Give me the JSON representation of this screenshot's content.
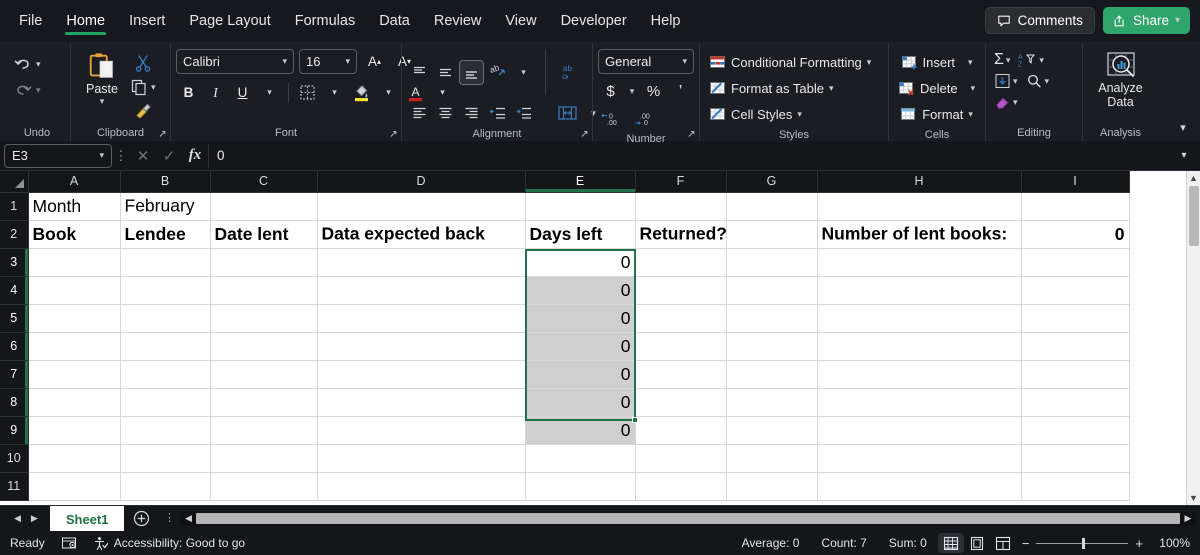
{
  "window": {
    "tabs": [
      "File",
      "Home",
      "Insert",
      "Page Layout",
      "Formulas",
      "Data",
      "Review",
      "View",
      "Developer",
      "Help"
    ],
    "active_tab": "Home",
    "comments_label": "Comments",
    "share_label": "Share"
  },
  "ribbon": {
    "groups": {
      "undo": {
        "label": "Undo"
      },
      "clipboard": {
        "label": "Clipboard",
        "paste_label": "Paste"
      },
      "font": {
        "label": "Font",
        "font_name": "Calibri",
        "font_size": "16"
      },
      "alignment": {
        "label": "Alignment"
      },
      "number": {
        "label": "Number",
        "format": "General"
      },
      "styles": {
        "label": "Styles",
        "items": [
          "Conditional Formatting",
          "Format as Table",
          "Cell Styles"
        ]
      },
      "cells": {
        "label": "Cells",
        "items": [
          "Insert",
          "Delete",
          "Format"
        ]
      },
      "editing": {
        "label": "Editing"
      },
      "analysis": {
        "label": "Analysis",
        "button_line1": "Analyze",
        "button_line2": "Data"
      }
    }
  },
  "formula_bar": {
    "name_box": "E3",
    "value": "0"
  },
  "sheet": {
    "columns": [
      "A",
      "B",
      "C",
      "D",
      "E",
      "F",
      "G",
      "H",
      "I"
    ],
    "selected_column": "E",
    "rows": [
      "1",
      "2",
      "3",
      "4",
      "5",
      "6",
      "7",
      "8",
      "9",
      "10",
      "11"
    ],
    "selected_rows": [
      "3",
      "4",
      "5",
      "6",
      "7",
      "8",
      "9"
    ],
    "cells": {
      "A1": "Month",
      "B1": "February",
      "A2": "Book",
      "B2": "Lendee",
      "C2": "Date lent",
      "D2": "Data expected back",
      "E2": "Days left",
      "F2": "Returned?",
      "H2": "Number of lent books:",
      "I2": "0",
      "E3": "0",
      "E4": "0",
      "E5": "0",
      "E6": "0",
      "E7": "0",
      "E8": "0",
      "E9": "0"
    },
    "selection_range": "E3:E9",
    "active_cell": "E3"
  },
  "sheet_tabs": {
    "tabs": [
      "Sheet1"
    ],
    "active": "Sheet1"
  },
  "status_bar": {
    "mode": "Ready",
    "accessibility": "Accessibility: Good to go",
    "average": "Average: 0",
    "count": "Count: 7",
    "sum": "Sum: 0",
    "zoom": "100%"
  }
}
